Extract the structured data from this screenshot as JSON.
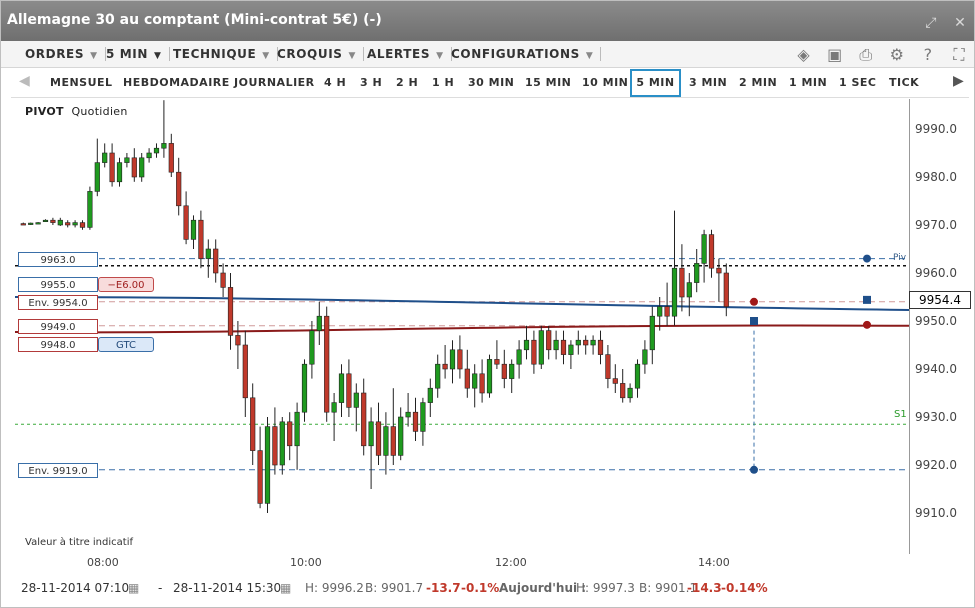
{
  "window": {
    "title": "Allemagne 30 au comptant (Mini-contrat 5€) (-)"
  },
  "menubar": {
    "items": [
      "ORDRES",
      "5 MIN",
      "TECHNIQUE",
      "CROQUIS",
      "ALERTES",
      "CONFIGURATIONS"
    ]
  },
  "timeframes": {
    "items": [
      "MENSUEL",
      "HEBDOMADAIRE",
      "JOURNALIER",
      "4 H",
      "3 H",
      "2 H",
      "1 H",
      "30 MIN",
      "15 MIN",
      "10 MIN",
      "5 MIN",
      "3 MIN",
      "2 MIN",
      "1 MIN",
      "1 SEC",
      "TICK"
    ],
    "active": "5 MIN"
  },
  "chart": {
    "pivot_label": "PIVOT",
    "pivot_period": "Quotidien",
    "note": "Valeur à titre indicatif",
    "current_price": "9954.4",
    "y_ticks": [
      "9990.0",
      "9980.0",
      "9970.0",
      "9960.0",
      "9950.0",
      "9940.0",
      "9930.0",
      "9920.0",
      "9910.0"
    ],
    "x_ticks": [
      "08:00",
      "10:00",
      "12:00",
      "14:00"
    ],
    "right_labels": {
      "pivot_short": "Piv",
      "s1": "S1"
    }
  },
  "orders": {
    "o1": "9963.0",
    "o2": "9955.0",
    "o2_tag": "−E6.00",
    "o3": "Env. 9954.0",
    "o4": "9949.0",
    "o5": "9948.0",
    "o5_tag": "GTC",
    "o6": "Env. 9919.0"
  },
  "footer": {
    "start": "28-11-2014 07:10",
    "dash": "-",
    "end": "28-11-2014 15:30",
    "h": "H: 9996.2",
    "b": "B: 9901.7",
    "chg": "-13.7",
    "chg_pct": "-0.1%",
    "today_label": "Aujourd'hui :",
    "today_h": "H: 9997.3",
    "today_b": "B: 9901.1",
    "today_chg": "-14.3",
    "today_chg_pct": "-0.14%"
  }
}
